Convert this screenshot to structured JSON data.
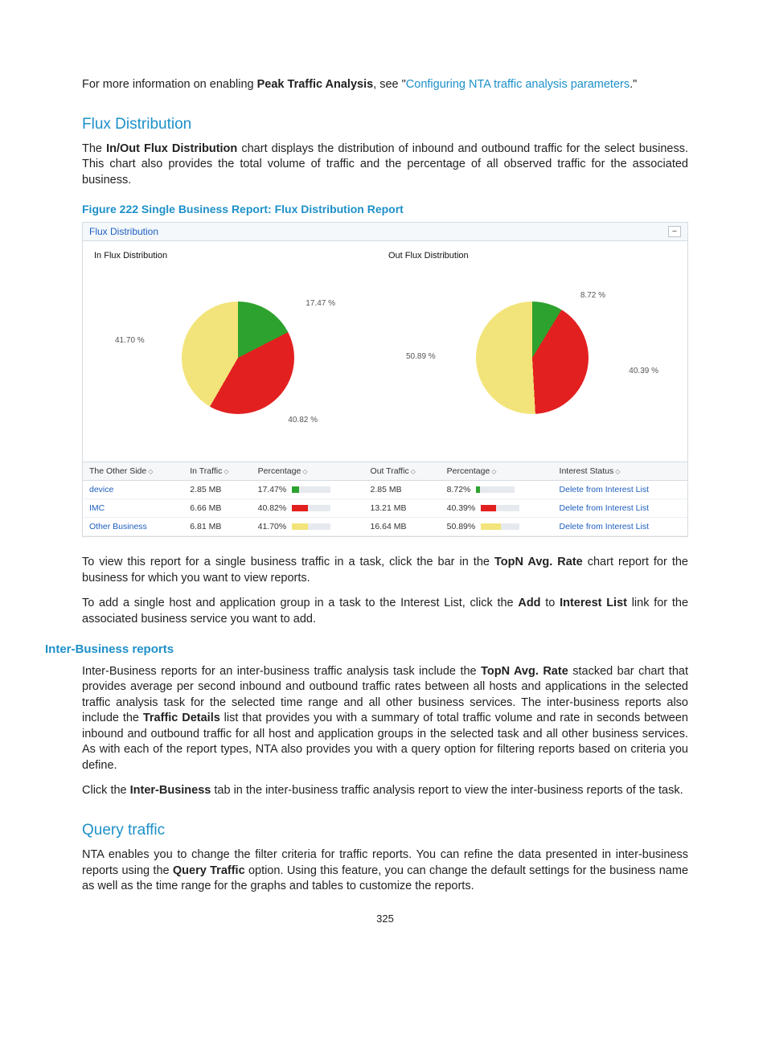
{
  "intro": {
    "pre": "For more information on enabling ",
    "bold1": "Peak Traffic Analysis",
    "mid": ", see \"",
    "link": "Configuring NTA traffic analysis parameters",
    "post": ".\""
  },
  "h_flux": "Flux Distribution",
  "p_flux": {
    "pre": "The ",
    "bold": "In/Out Flux Distribution",
    "rest": " chart displays the distribution of inbound and outbound traffic for the select business. This chart also provides the total volume of traffic and the percentage of all observed traffic for the associated business."
  },
  "fig_caption": "Figure 222 Single Business Report: Flux Distribution Report",
  "report": {
    "title": "Flux Distribution",
    "in_title": "In Flux Distribution",
    "out_title": "Out Flux Distribution",
    "labels_in": {
      "green": "17.47 %",
      "red": "40.82 %",
      "yellow": "41.70 %"
    },
    "labels_out": {
      "green": "8.72 %",
      "red": "40.39 %",
      "yellow": "50.89 %"
    },
    "columns": [
      "The Other Side",
      "In Traffic",
      "Percentage",
      "Out Traffic",
      "Percentage",
      "Interest Status"
    ],
    "rows": [
      {
        "name": "device",
        "link": true,
        "in_t": "2.85 MB",
        "in_p": "17.47%",
        "in_w": 18,
        "in_c": "c-green",
        "out_t": "2.85 MB",
        "out_p": "8.72%",
        "out_w": 9,
        "out_c": "c-green",
        "status": "Delete from Interest List",
        "status_link": true
      },
      {
        "name": "IMC",
        "link": true,
        "in_t": "6.66 MB",
        "in_p": "40.82%",
        "in_w": 41,
        "in_c": "c-red",
        "out_t": "13.21 MB",
        "out_p": "40.39%",
        "out_w": 40,
        "out_c": "c-red",
        "status": "Delete from Interest List",
        "status_link": true
      },
      {
        "name": "Other Business",
        "link": true,
        "in_t": "6.81 MB",
        "in_p": "41.70%",
        "in_w": 42,
        "in_c": "c-yellow",
        "out_t": "16.64 MB",
        "out_p": "50.89%",
        "out_w": 51,
        "out_c": "c-yellow",
        "status": "Delete from Interest List",
        "status_link": true
      }
    ]
  },
  "p_view": {
    "pre": "To view this report for a single business traffic in a task, click the bar in the ",
    "bold": "TopN Avg. Rate",
    "rest": " chart report for the business for which you want to view reports."
  },
  "p_add": {
    "pre": "To add a single host and application group in a task to the Interest List, click the ",
    "b1": "Add",
    "mid": " to ",
    "b2": "Interest List",
    "rest": " link for the associated business service you want to add."
  },
  "h_inter": "Inter-Business reports",
  "p_inter1": {
    "pre": "Inter-Business reports for an inter-business traffic analysis task include the ",
    "b1": "TopN Avg. Rate",
    "mid1": " stacked bar chart that provides average per second inbound and outbound traffic rates between all hosts and applications in the selected traffic analysis task for the selected time range and all other business services. The inter-business reports also include the ",
    "b2": "Traffic Details",
    "rest": " list that provides you with a summary of total traffic volume and rate in seconds between inbound and outbound traffic for all host and application groups in the selected task and all other business services. As with each of the report types, NTA also provides you with a query option for filtering reports based on criteria you define."
  },
  "p_inter2": {
    "pre": "Click the ",
    "b": "Inter-Business",
    "rest": " tab in the inter-business traffic analysis report to view the inter-business reports of the task."
  },
  "h_query": "Query traffic",
  "p_query": {
    "pre": "NTA enables you to change the filter criteria for traffic reports. You can refine the data presented in inter-business reports using the ",
    "b": "Query Traffic",
    "rest": " option. Using this feature, you can change the default settings for the business name as well as the time range for the graphs and tables to customize the reports."
  },
  "pagenum": "325",
  "chart_data": [
    {
      "type": "pie",
      "title": "In Flux Distribution",
      "series": [
        {
          "name": "device",
          "value": 17.47,
          "color": "#2ea22e"
        },
        {
          "name": "IMC",
          "value": 40.82,
          "color": "#e32020"
        },
        {
          "name": "Other Business",
          "value": 41.7,
          "color": "#f2e47a"
        }
      ]
    },
    {
      "type": "pie",
      "title": "Out Flux Distribution",
      "series": [
        {
          "name": "device",
          "value": 8.72,
          "color": "#2ea22e"
        },
        {
          "name": "IMC",
          "value": 40.39,
          "color": "#e32020"
        },
        {
          "name": "Other Business",
          "value": 50.89,
          "color": "#f2e47a"
        }
      ]
    }
  ]
}
